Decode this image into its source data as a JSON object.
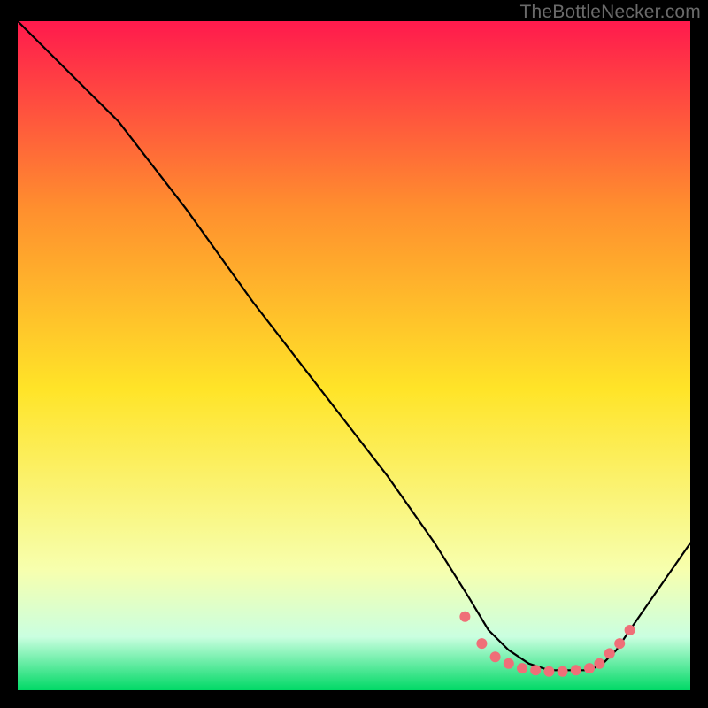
{
  "watermark": "TheBottleNecker.com",
  "chart_data": {
    "type": "line",
    "title": "",
    "xlabel": "",
    "ylabel": "",
    "xlim": [
      0,
      100
    ],
    "ylim": [
      0,
      100
    ],
    "background_gradient": {
      "top": "#ff1a4d",
      "upper_mid": "#ff8f2e",
      "mid": "#ffe428",
      "lower_mid": "#f7ffae",
      "low": "#caffe0",
      "bottom": "#00d966"
    },
    "series": [
      {
        "name": "curve",
        "color": "#000000",
        "x": [
          0,
          8,
          15,
          25,
          35,
          45,
          55,
          62,
          67,
          70,
          73,
          76,
          79,
          82,
          85,
          87,
          89,
          91,
          100
        ],
        "y": [
          100,
          92,
          85,
          72,
          58,
          45,
          32,
          22,
          14,
          9,
          6,
          4,
          3,
          3,
          3,
          4,
          6,
          9,
          22
        ]
      }
    ],
    "markers": {
      "name": "dots",
      "color": "#ef6f78",
      "x": [
        66.5,
        69,
        71,
        73,
        75,
        77,
        79,
        81,
        83,
        85,
        86.5,
        88,
        89.5,
        91
      ],
      "y": [
        11,
        7,
        5,
        4,
        3.3,
        3,
        2.8,
        2.8,
        3,
        3.3,
        4,
        5.5,
        7,
        9
      ]
    }
  }
}
